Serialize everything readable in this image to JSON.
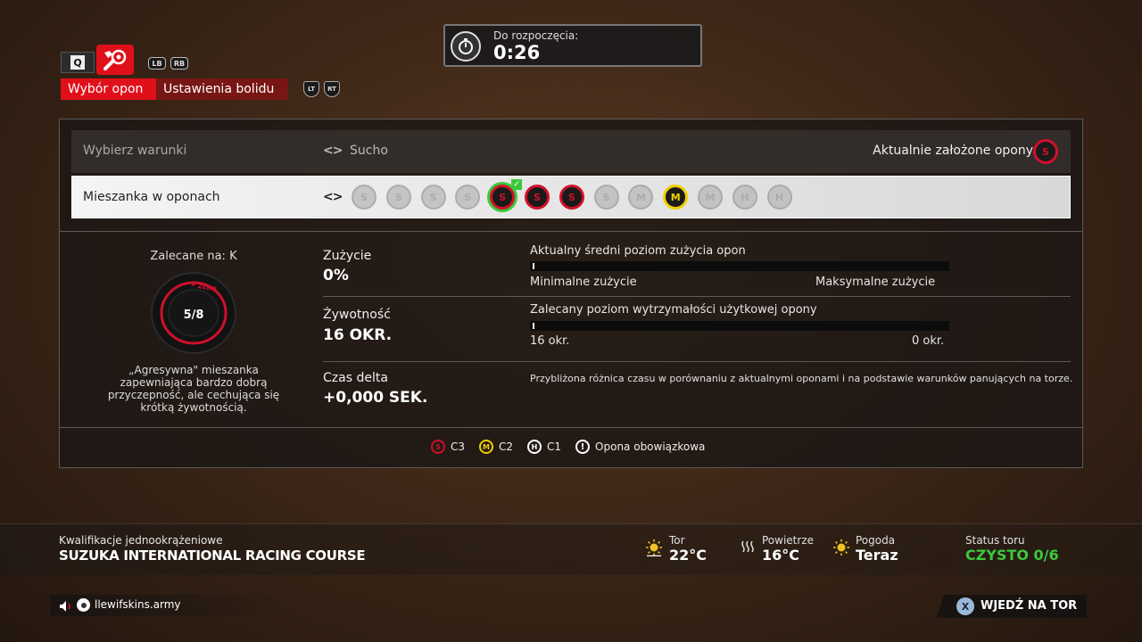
{
  "nav": {
    "lb": "LB",
    "rb": "RB",
    "lt": "LT",
    "rt": "RT",
    "tabs": [
      {
        "label": "Wybór opon",
        "active": true
      },
      {
        "label": "Ustawienia bolidu",
        "active": false
      }
    ]
  },
  "timer": {
    "label": "Do rozpoczęcia:",
    "value": "0:26"
  },
  "conditions": {
    "label": "Wybierz warunki",
    "value": "Sucho",
    "current_tyres_label": "Aktualnie założone opony",
    "current_tyre": "S"
  },
  "compound": {
    "label": "Mieszanka w oponach",
    "tyres": [
      {
        "letter": "S",
        "state": "dim"
      },
      {
        "letter": "S",
        "state": "dim"
      },
      {
        "letter": "S",
        "state": "dim"
      },
      {
        "letter": "S",
        "state": "dim"
      },
      {
        "letter": "S",
        "state": "selected"
      },
      {
        "letter": "S",
        "state": "new"
      },
      {
        "letter": "S",
        "state": "new"
      },
      {
        "letter": "S",
        "state": "dim"
      },
      {
        "letter": "M",
        "state": "dim"
      },
      {
        "letter": "M",
        "state": "new"
      },
      {
        "letter": "M",
        "state": "dim"
      },
      {
        "letter": "H",
        "state": "dim"
      },
      {
        "letter": "H",
        "state": "dim"
      }
    ]
  },
  "recommendation": {
    "label": "Zalecane na: K",
    "tyre_count": "5/8",
    "brand": "P ZERO",
    "description": "„Agresywna\" mieszanka zapewniająca bardzo dobrą przyczepność, ale cechująca się krótką żywotnością."
  },
  "stats": {
    "wear_label": "Zużycie",
    "wear_value": "0%",
    "wear_bar_title": "Aktualny średni poziom zużycia opon",
    "wear_min": "Minimalne zużycie",
    "wear_max": "Maksymalne zużycie",
    "life_label": "Żywotność",
    "life_value": "16 OKR.",
    "life_bar_title": "Zalecany poziom wytrzymałości użytkowej opony",
    "life_left": "16 okr.",
    "life_right": "0 okr.",
    "delta_label": "Czas delta",
    "delta_value": "+0,000 SEK.",
    "delta_desc": "Przybliżona różnica czasu w porównaniu z aktualnymi oponami i na podstawie warunków panujących na torze."
  },
  "legend": {
    "s": "S",
    "s_label": "C3",
    "m": "M",
    "m_label": "C2",
    "h": "H",
    "h_label": "C1",
    "mandatory": "Opona obowiązkowa"
  },
  "session": {
    "type": "Kwalifikacje jednookrążeniowe",
    "track": "SUZUKA INTERNATIONAL RACING COURSE"
  },
  "weather": {
    "track_label": "Tor",
    "track_value": "22°C",
    "air_label": "Powietrze",
    "air_value": "16°C",
    "forecast_label": "Pogoda",
    "forecast_value": "Teraz",
    "status_label": "Status toru",
    "status_value": "CZYSTO 0/6"
  },
  "footer": {
    "username": "llewifskins.army",
    "enter_track": "WJEDŹ NA TOR",
    "x_button": "X"
  },
  "colors": {
    "red": "#e0101a",
    "soft": "#d0102a",
    "medium": "#f0d000",
    "hard": "#ffffff",
    "green": "#3cc83c"
  }
}
